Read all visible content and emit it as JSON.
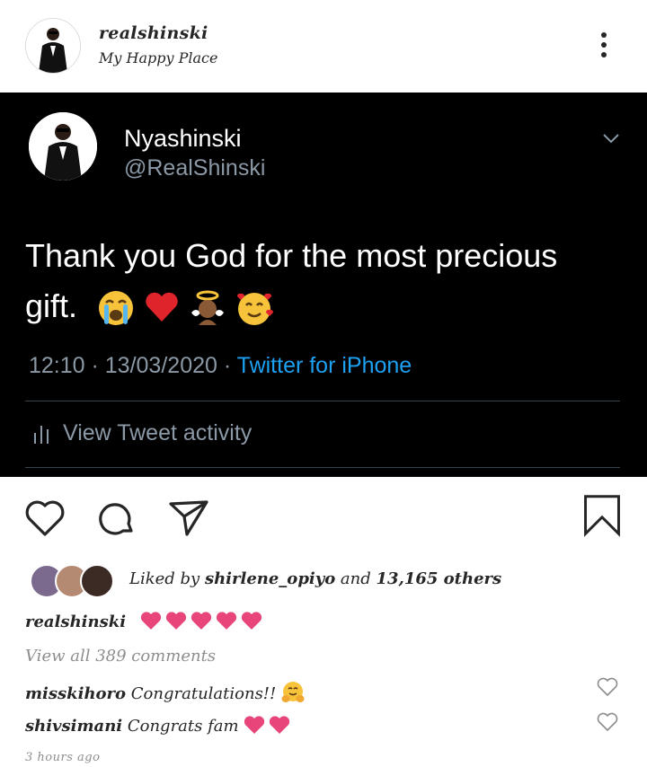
{
  "header": {
    "username": "realshinski",
    "location": "My Happy Place",
    "avatar_icon": "profile-photo-man-in-black-suit",
    "more_icon": "more-options-icon"
  },
  "tweet": {
    "display_name": "Nyashinski",
    "handle": "@RealShinski",
    "text": "Thank you God for the most precious gift.",
    "emojis": [
      "crying-face",
      "red-heart",
      "baby-angel",
      "smiling-face-with-hearts"
    ],
    "time": "12:10 · 13/03/2020 · ",
    "source": "Twitter for iPhone",
    "activity": "View Tweet activity",
    "colors": {
      "background": "#000000",
      "link": "#1da1f2",
      "secondary": "#8b98a5"
    }
  },
  "actions": {
    "like_icon": "heart-outline-icon",
    "comment_icon": "comment-bubble-icon",
    "share_icon": "paper-plane-icon",
    "save_icon": "bookmark-icon"
  },
  "likes": {
    "prefix": "Liked by ",
    "user": "shirlene_opiyo",
    "middle": " and ",
    "others": "13,165 others"
  },
  "caption": {
    "username": "realshinski",
    "hearts": 5,
    "heart_color": "#e8457a"
  },
  "comments": {
    "view_all": "View all 389 comments",
    "items": [
      {
        "user": "misskihoro",
        "text": " Congratulations!! ",
        "emoji": "hugging-face"
      },
      {
        "user": "shivsimani",
        "text": " Congrats fam ",
        "emoji": "two-hearts"
      }
    ]
  },
  "timestamp": "3 hours ago"
}
